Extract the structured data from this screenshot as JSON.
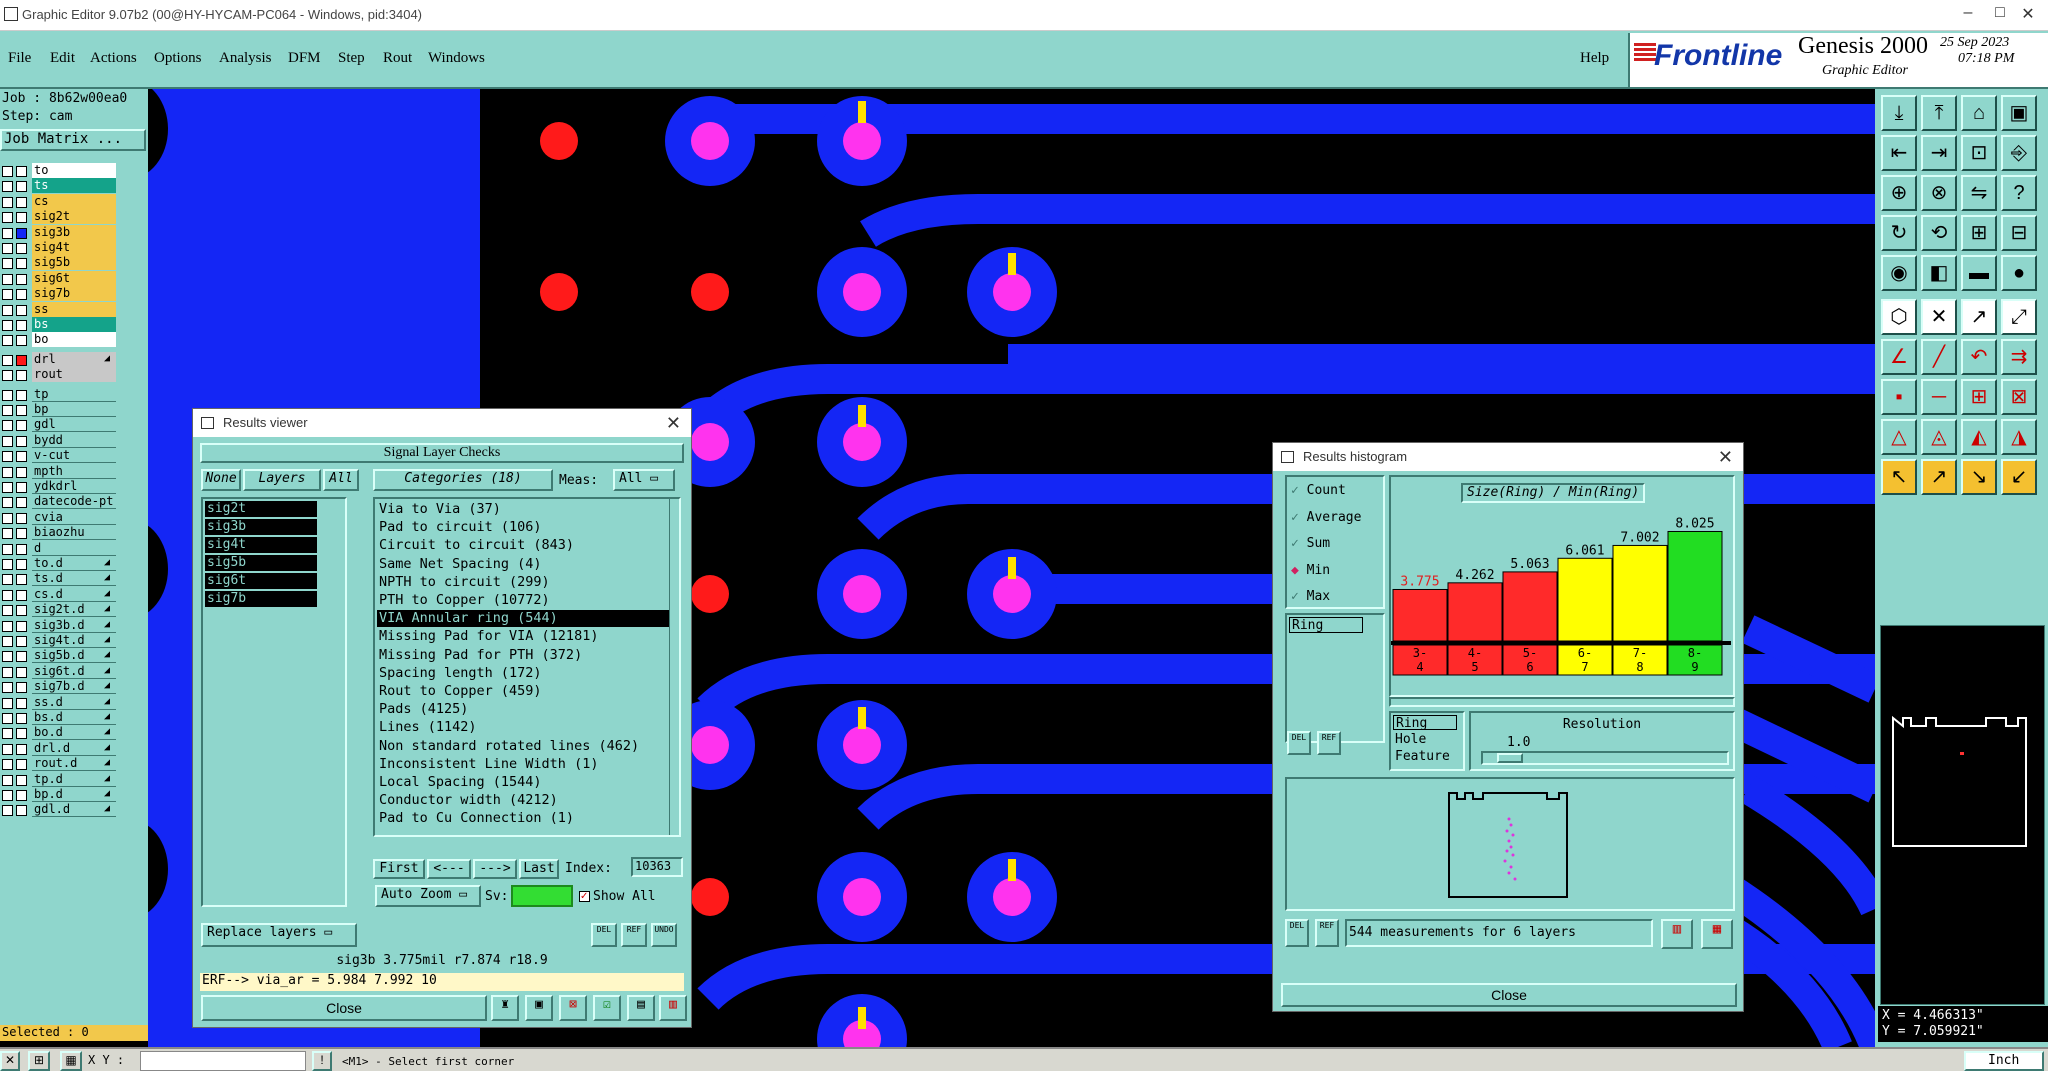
{
  "window": {
    "title": "Graphic Editor 9.07b2 (00@HY-HYCAM-PC064 - Windows, pid:3404)"
  },
  "menu": [
    "File",
    "Edit",
    "Actions",
    "Options",
    "Analysis",
    "DFM",
    "Step",
    "Rout",
    "Windows"
  ],
  "help": "Help",
  "brand": {
    "logo": "Frontline",
    "product": "Genesis 2000",
    "subtitle": "Graphic Editor",
    "date": "25 Sep 2023",
    "time": "07:18 PM"
  },
  "job": {
    "job_label": "Job : 8b62w00ea0",
    "step_label": "Step: cam",
    "matrix_button": "Job Matrix ..."
  },
  "layers": [
    {
      "name": "to",
      "color": "#ffffff"
    },
    {
      "name": "ts",
      "color": "#14a38a"
    },
    {
      "name": "cs",
      "color": "#f2c84b"
    },
    {
      "name": "sig2t",
      "color": "#f2c84b"
    },
    {
      "name": "sig3b",
      "color": "#f2c84b"
    },
    {
      "name": "sig4t",
      "color": "#f2c84b"
    },
    {
      "name": "sig5b",
      "color": "#f2c84b"
    },
    {
      "name": "sig6t",
      "color": "#f2c84b"
    },
    {
      "name": "sig7b",
      "color": "#f2c84b"
    },
    {
      "name": "ss",
      "color": "#f2c84b"
    },
    {
      "name": "bs",
      "color": "#14a38a"
    },
    {
      "name": "bo",
      "color": "#ffffff"
    }
  ],
  "drill_layers": [
    {
      "name": "drl",
      "color": "#c8c8c8"
    },
    {
      "name": "rout",
      "color": "#c8c8c8"
    }
  ],
  "misc_layers": [
    "tp",
    "bp",
    "gdl",
    "bydd",
    "v-cut",
    "mpth",
    "ydkdrl",
    "datecode-pt",
    "cvia",
    "biaozhu",
    "d",
    "to.d",
    "ts.d",
    "cs.d",
    "sig2t.d",
    "sig3b.d",
    "sig4t.d",
    "sig5b.d",
    "sig6t.d",
    "sig7b.d",
    "ss.d",
    "bs.d",
    "bo.d",
    "drl.d",
    "rout.d",
    "tp.d",
    "bp.d",
    "gdl.d"
  ],
  "selected": "Selected : 0",
  "results_viewer": {
    "title": "Results viewer",
    "header": "Signal Layer Checks",
    "none_btn": "None",
    "layers_btn": "Layers",
    "all_btn": "All",
    "categories_btn": "Categories (18)",
    "meas_label": "Meas:",
    "meas_value": "All",
    "layers": [
      "sig2t",
      "sig3b",
      "sig4t",
      "sig5b",
      "sig6t",
      "sig7b"
    ],
    "categories": [
      "Via to Via (37)",
      "Pad to circuit (106)",
      "Circuit to circuit (843)",
      "Same Net Spacing (4)",
      "NPTH to circuit (299)",
      "PTH to Copper (10772)",
      "VIA Annular ring (544)",
      "Missing Pad for VIA (12181)",
      "Missing Pad for PTH (372)",
      "Spacing length (172)",
      "Rout to Copper (459)",
      "Pads (4125)",
      "Lines (1142)",
      "Non standard rotated lines (462)",
      "Inconsistent Line Width (1)",
      "Local Spacing (1544)",
      "Conductor width (4212)",
      "Pad to Cu Connection (1)"
    ],
    "selected_index": 6,
    "nav": {
      "first": "First",
      "prev": "<---",
      "next": "--->",
      "last": "Last",
      "index_label": "Index:",
      "index_value": "10363"
    },
    "auto_zoom": "Auto Zoom",
    "sv_label": "Sv:",
    "show_all": "Show All",
    "replace_layers": "Replace layers",
    "info_line": "sig3b 3.775mil   r7.874   r18.9",
    "erf_line": "ERF--> via_ar = 5.984 7.992 10",
    "close": "Close"
  },
  "histogram": {
    "title": "Results histogram",
    "options": [
      "Count",
      "Average",
      "Sum",
      "Min",
      "Max"
    ],
    "selected_option": "Min",
    "ring_list": [
      "Ring"
    ],
    "chart_title": "Size(Ring) / Min(Ring)",
    "resolution_label": "Resolution",
    "resolution_value": "1.0",
    "type_list": [
      "Ring",
      "Hole",
      "Feature"
    ],
    "measurements": "544 measurements for 6 layers",
    "close": "Close"
  },
  "chart_data": {
    "type": "bar",
    "title": "Size(Ring) / Min(Ring)",
    "categories": [
      "3-4",
      "4-5",
      "5-6",
      "6-7",
      "7-8",
      "8-9"
    ],
    "values": [
      3.775,
      4.262,
      5.063,
      6.061,
      7.002,
      8.025
    ],
    "value_labels": [
      "3.775",
      "4.262",
      "5.063",
      "6.061",
      "7.002",
      "8.025"
    ],
    "colors": [
      "#ff2a2a",
      "#ff2a2a",
      "#ff2a2a",
      "#ffff00",
      "#ffff00",
      "#22dd22"
    ],
    "ylim": [
      0,
      8.5
    ]
  },
  "coords": {
    "x": "X = 4.466313\"",
    "y": "Y = 7.059921\""
  },
  "status": {
    "xy_label": "X Y :",
    "message": "<M1> - Select first corner",
    "units": "Inch"
  }
}
